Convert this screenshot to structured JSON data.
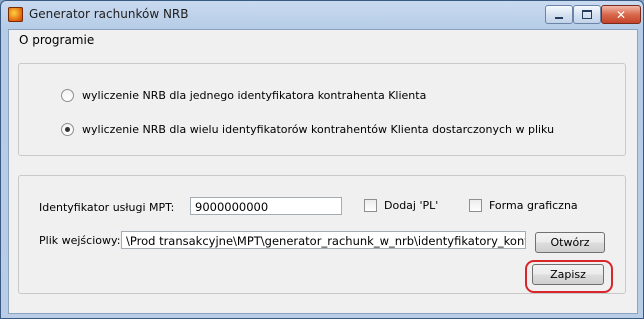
{
  "window": {
    "title": "Generator rachunków NRB",
    "icon": "app-icon"
  },
  "menu": {
    "items": [
      "O programie"
    ]
  },
  "mode": {
    "options": [
      {
        "label": "wyliczenie NRB dla jednego identyfikatora kontrahenta Klienta",
        "checked": false
      },
      {
        "label": "wyliczenie NRB dla wielu identyfikatorów kontrahentów Klienta dostarczonych w pliku",
        "checked": true
      }
    ]
  },
  "form": {
    "service_id_label": "Identyfikator usługi MPT:",
    "service_id_value": "9000000000",
    "add_pl_label": "Dodaj 'PL'",
    "add_pl_checked": false,
    "graphic_form_label": "Forma graficzna",
    "graphic_form_checked": false,
    "input_file_label": "Plik wejściowy:",
    "input_file_value": "\\Prod transakcyjne\\MPT\\generator_rachunk_w_nrb\\identyfikatory_kontrahentów.txt",
    "open_button": "Otwórz",
    "save_button": "Zapisz"
  },
  "colors": {
    "highlight": "#d8262a",
    "close_button": "#c3442a"
  }
}
